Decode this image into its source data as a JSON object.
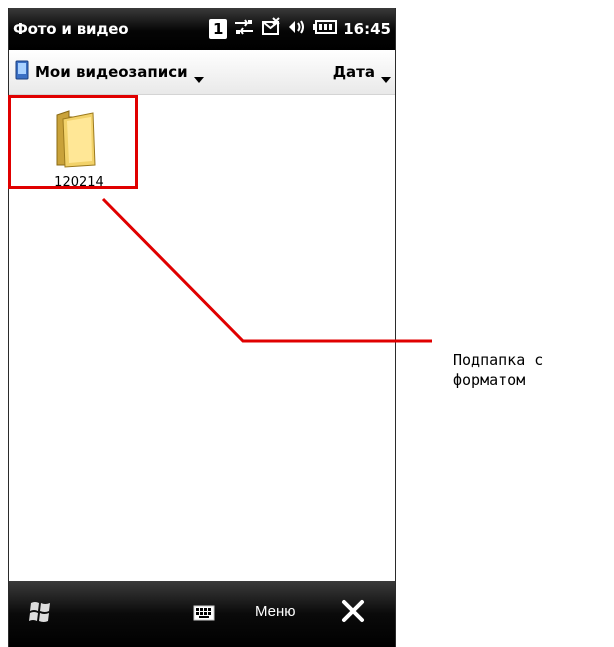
{
  "statusbar": {
    "app_title": "Фото и видео",
    "sim_indicator": "1",
    "time": "16:45",
    "icons": [
      "sim-icon",
      "sync-arrows-icon",
      "message-icon",
      "volume-icon",
      "battery-icon"
    ]
  },
  "navbar": {
    "folder_label": "Мои видеозаписи",
    "sort_label": "Дата"
  },
  "content": {
    "items": [
      {
        "label": "120214",
        "icon": "folder-icon"
      }
    ]
  },
  "softbar": {
    "menu_label": "Меню",
    "icons": [
      "windows-start-icon",
      "keyboard-icon",
      "close-icon"
    ]
  },
  "annotation": {
    "text": "Подпапка с\nформатом",
    "color": "#e00000"
  }
}
